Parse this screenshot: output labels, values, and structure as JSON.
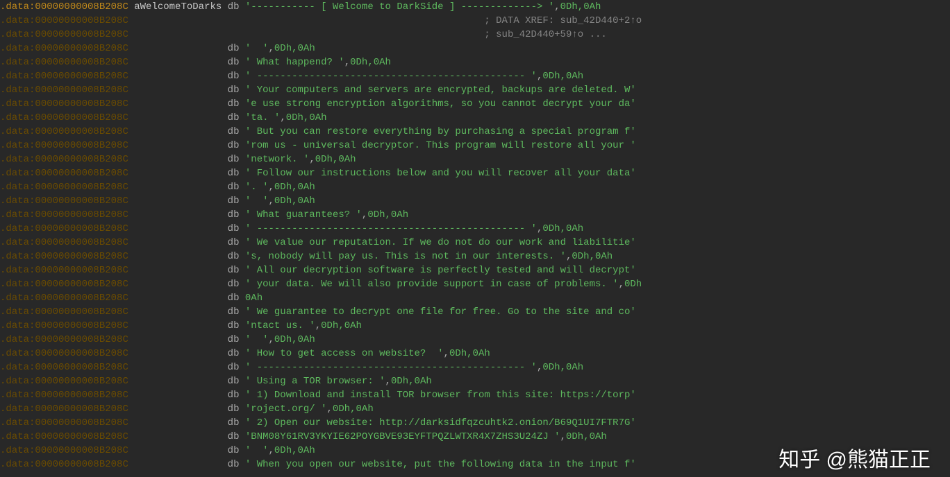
{
  "segment": ".data",
  "address": "00000000008B208C",
  "label": "aWelcomeToDarks",
  "db": "db",
  "quote": "'",
  "comma": ",",
  "xref_prefix": "; DATA XREF: ",
  "xref1": "sub_42D440+2↑o",
  "xref2_prefix": "; ",
  "xref2": "sub_42D440+59↑o ...",
  "crlf": "0Dh,0Ah",
  "cr": "0Dh",
  "lf": "0Ah",
  "pad_body": "                                     ",
  "xref_indent": "                                                             ",
  "lines": [
    {
      "active": true,
      "label": true,
      "str": "----------- [ Welcome to DarkSide ] -------------> ",
      "crlf": true
    },
    {
      "xref": 1
    },
    {
      "xref": 2
    },
    {
      "str": "  ",
      "crlf": true
    },
    {
      "str": " What happend? ",
      "crlf": true
    },
    {
      "str": " ---------------------------------------------- ",
      "crlf": true
    },
    {
      "str": " Your computers and servers are encrypted, backups are deleted. W"
    },
    {
      "str": "e use strong encryption algorithms, so you cannot decrypt your da"
    },
    {
      "str": "ta. ",
      "crlf": true
    },
    {
      "str": " But you can restore everything by purchasing a special program f"
    },
    {
      "str": "rom us - universal decryptor. This program will restore all your "
    },
    {
      "str": "network. ",
      "crlf": true
    },
    {
      "str": " Follow our instructions below and you will recover all your data"
    },
    {
      "str": ". ",
      "crlf": true
    },
    {
      "str": "  ",
      "crlf": true
    },
    {
      "str": " What guarantees? ",
      "crlf": true
    },
    {
      "str": " ---------------------------------------------- ",
      "crlf": true
    },
    {
      "str": " We value our reputation. If we do not do our work and liabilitie"
    },
    {
      "str": "s, nobody will pay us. This is not in our interests. ",
      "crlf": true
    },
    {
      "str": " All our decryption software is perfectly tested and will decrypt"
    },
    {
      "str": " your data. We will also provide support in case of problems. ",
      "cr_only": true
    },
    {
      "lf_only": true
    },
    {
      "str": " We guarantee to decrypt one file for free. Go to the site and co"
    },
    {
      "str": "ntact us. ",
      "crlf": true
    },
    {
      "str": "  ",
      "crlf": true
    },
    {
      "str": " How to get access on website?  ",
      "crlf": true
    },
    {
      "str": " ---------------------------------------------- ",
      "crlf": true
    },
    {
      "str": " Using a TOR browser: ",
      "crlf": true
    },
    {
      "str": " 1) Download and install TOR browser from this site: https://torp"
    },
    {
      "str": "roject.org/ ",
      "crlf": true
    },
    {
      "str": " 2) Open our website: http://darksidfqzcuhtk2.onion/B69Q1UI7FTR7G"
    },
    {
      "str": "BNM08Y61RV3YKYIE62POYGBVE93EYFTPQZLWTXR4X7ZHS3U24ZJ ",
      "crlf": true
    },
    {
      "str": "  ",
      "crlf": true
    },
    {
      "str": " When you open our website, put the following data in the input f"
    }
  ],
  "watermark": "知乎 @熊猫正正"
}
